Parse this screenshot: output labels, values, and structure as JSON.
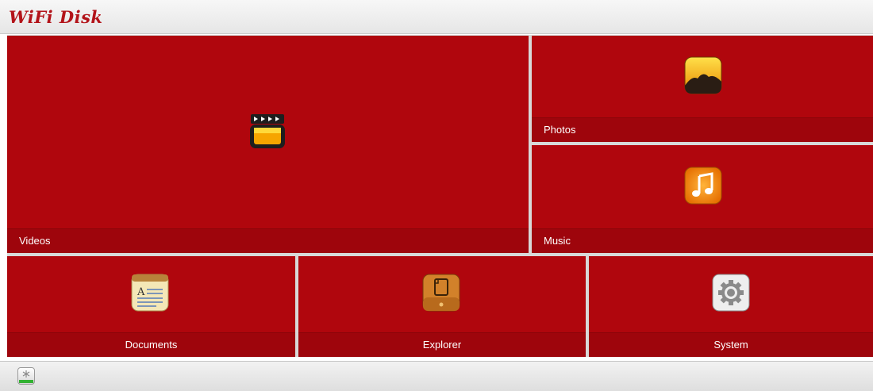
{
  "app": {
    "title": "WiFi Disk"
  },
  "colors": {
    "tile": "#b0060d",
    "tile_label_bar": "#9e050c",
    "logo": "#b3141a"
  },
  "tiles": [
    {
      "id": "videos",
      "label": "Videos",
      "icon": "clapperboard-icon"
    },
    {
      "id": "photos",
      "label": "Photos",
      "icon": "photo-landscape-icon"
    },
    {
      "id": "music",
      "label": "Music",
      "icon": "music-note-icon"
    },
    {
      "id": "documents",
      "label": "Documents",
      "icon": "document-icon"
    },
    {
      "id": "explorer",
      "label": "Explorer",
      "icon": "folder-explorer-icon"
    },
    {
      "id": "system",
      "label": "System",
      "icon": "gear-icon"
    }
  ],
  "footer": {
    "status_icon": "wifi-status-icon"
  }
}
